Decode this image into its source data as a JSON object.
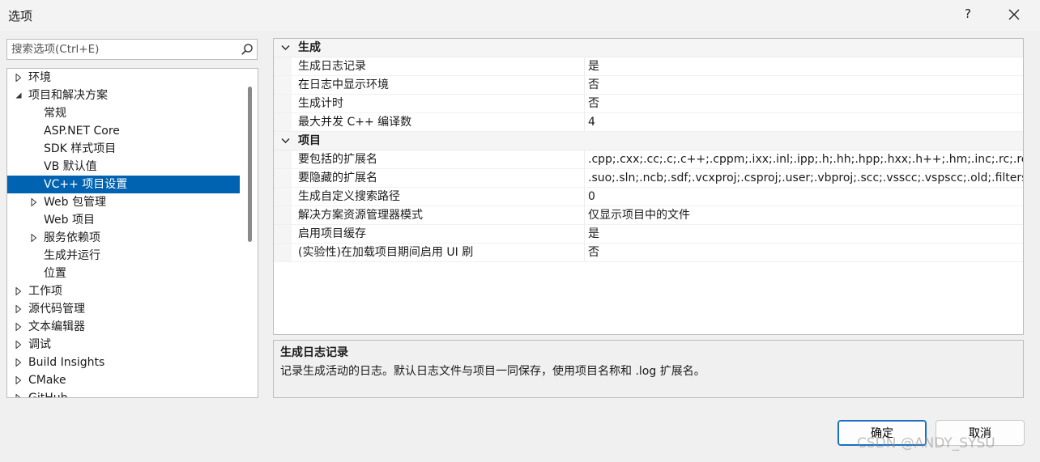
{
  "window": {
    "title": "选项",
    "help_label": "?"
  },
  "search": {
    "placeholder": "搜索选项(Ctrl+E)"
  },
  "tree": {
    "items": [
      {
        "label": "环境"
      },
      {
        "label": "项目和解决方案"
      },
      {
        "label": "常规"
      },
      {
        "label": "ASP.NET Core"
      },
      {
        "label": "SDK 样式项目"
      },
      {
        "label": "VB 默认值"
      },
      {
        "label": "VC++ 项目设置"
      },
      {
        "label": "Web 包管理"
      },
      {
        "label": "Web 项目"
      },
      {
        "label": "服务依赖项"
      },
      {
        "label": "生成并运行"
      },
      {
        "label": "位置"
      },
      {
        "label": "工作项"
      },
      {
        "label": "源代码管理"
      },
      {
        "label": "文本编辑器"
      },
      {
        "label": "调试"
      },
      {
        "label": "Build Insights"
      },
      {
        "label": "CMake"
      },
      {
        "label": "GitHub"
      }
    ]
  },
  "grid": {
    "categories": [
      {
        "title": "生成",
        "rows": [
          {
            "name": "生成日志记录",
            "value": "是"
          },
          {
            "name": "在日志中显示环境",
            "value": "否"
          },
          {
            "name": "生成计时",
            "value": "否"
          },
          {
            "name": "最大并发 C++ 编译数",
            "value": "4"
          }
        ]
      },
      {
        "title": "项目",
        "rows": [
          {
            "name": "要包括的扩展名",
            "value": ".cpp;.cxx;.cc;.c;.c++;.cppm;.ixx;.inl;.ipp;.h;.hh;.hpp;.hxx;.h++;.hm;.inc;.rc;.resx;.idl;.rc2;.def;.odl;.asm;.asmx;.xsd;.bin;.rgs;.html;.htm"
          },
          {
            "name": "要隐藏的扩展名",
            "value": ".suo;.sln;.ncb;.sdf;.vcxproj;.csproj;.user;.vbproj;.scc;.vsscc;.vspscc;.old;.filters"
          },
          {
            "name": "生成自定义搜索路径",
            "value": "0"
          },
          {
            "name": "解决方案资源管理器模式",
            "value": "仅显示项目中的文件"
          },
          {
            "name": "启用项目缓存",
            "value": "是"
          },
          {
            "name": "(实验性)在加载项目期间启用 UI 刷",
            "value": "否"
          }
        ]
      }
    ]
  },
  "description": {
    "title": "生成日志记录",
    "text": "记录生成活动的日志。默认日志文件与项目一同保存，使用项目名称和 .log 扩展名。"
  },
  "buttons": {
    "ok": "确定",
    "cancel": "取消"
  },
  "watermark": "CSDN @ANDY_SYSU"
}
